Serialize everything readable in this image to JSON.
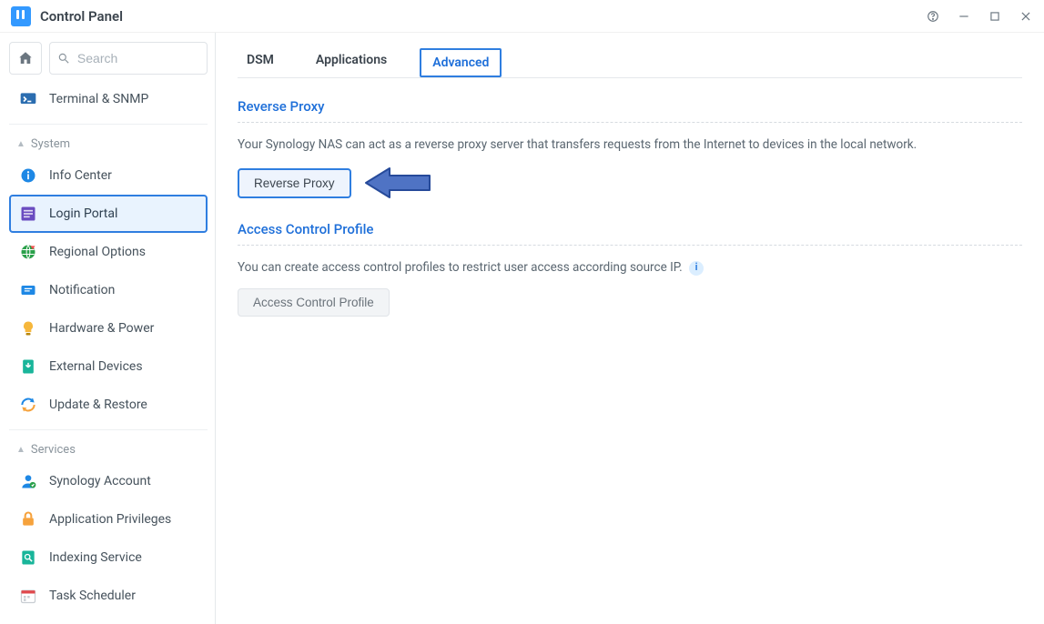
{
  "window": {
    "title": "Control Panel"
  },
  "search": {
    "placeholder": "Search"
  },
  "sidebar": {
    "top_item": {
      "label": "Terminal & SNMP"
    },
    "groups": [
      {
        "title": "System",
        "items": [
          {
            "label": "Info Center"
          },
          {
            "label": "Login Portal",
            "selected": true
          },
          {
            "label": "Regional Options"
          },
          {
            "label": "Notification"
          },
          {
            "label": "Hardware & Power"
          },
          {
            "label": "External Devices"
          },
          {
            "label": "Update & Restore"
          }
        ]
      },
      {
        "title": "Services",
        "items": [
          {
            "label": "Synology Account"
          },
          {
            "label": "Application Privileges"
          },
          {
            "label": "Indexing Service"
          },
          {
            "label": "Task Scheduler"
          }
        ]
      }
    ]
  },
  "tabs": {
    "items": [
      {
        "label": "DSM"
      },
      {
        "label": "Applications"
      },
      {
        "label": "Advanced",
        "active": true
      }
    ]
  },
  "sections": {
    "reverse_proxy": {
      "title": "Reverse Proxy",
      "desc": "Your Synology NAS can act as a reverse proxy server that transfers requests from the Internet to devices in the local network.",
      "button": "Reverse Proxy"
    },
    "access_control": {
      "title": "Access Control Profile",
      "desc": "You can create access control profiles to restrict user access according source IP.",
      "button": "Access Control Profile"
    }
  },
  "colors": {
    "accent": "#2f7ee0",
    "link": "#1e6fd9"
  }
}
